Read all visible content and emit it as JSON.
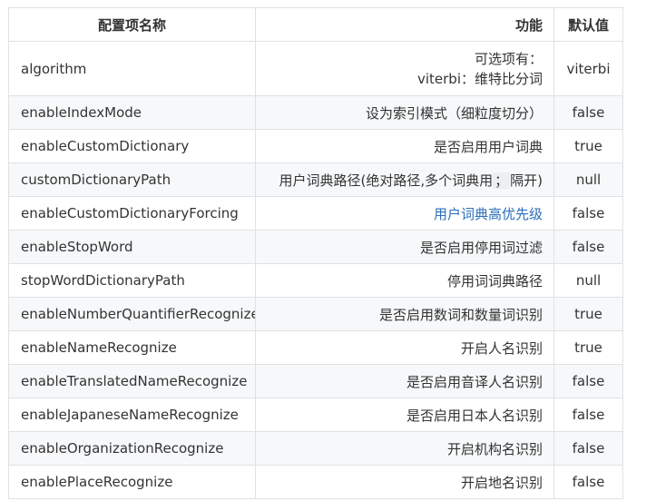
{
  "table": {
    "headers": {
      "name": "配置项名称",
      "function": "功能",
      "default": "默认值"
    },
    "rows": [
      {
        "name": "algorithm",
        "func_line1": "可选项有：",
        "func_line2": "viterbi：维特比分词",
        "default": "viterbi"
      },
      {
        "name": "enableIndexMode",
        "func": "设为索引模式（细粒度切分）",
        "default": "false"
      },
      {
        "name": "enableCustomDictionary",
        "func": "是否启用用户词典",
        "default": "true"
      },
      {
        "name": "customDictionaryPath",
        "func_pre": "用户词典路径(绝对路径,多个词典用",
        "func_mark": "；",
        "func_post": "隔开)",
        "default": "null"
      },
      {
        "name": "enableCustomDictionaryForcing",
        "func": "用户词典高优先级",
        "default": "false"
      },
      {
        "name": "enableStopWord",
        "func": "是否启用停用词过滤",
        "default": "false"
      },
      {
        "name": "stopWordDictionaryPath",
        "func": "停用词词典路径",
        "default": "null"
      },
      {
        "name": "enableNumberQuantifierRecognize",
        "func": "是否启用数词和数量词识别",
        "default": "true"
      },
      {
        "name": "enableNameRecognize",
        "func": "开启人名识别",
        "default": "true"
      },
      {
        "name": "enableTranslatedNameRecognize",
        "func": "是否启用音译人名识别",
        "default": "false"
      },
      {
        "name": "enableJapaneseNameRecognize",
        "func": "是否启用日本人名识别",
        "default": "false"
      },
      {
        "name": "enableOrganizationRecognize",
        "func": "开启机构名识别",
        "default": "false"
      },
      {
        "name": "enablePlaceRecognize",
        "func": "开启地名识别",
        "default": "false"
      }
    ]
  },
  "colors": {
    "border": "#dfe2e5",
    "stripe": "#f6f8fa",
    "link": "#2a6fb8",
    "text": "#333333"
  }
}
